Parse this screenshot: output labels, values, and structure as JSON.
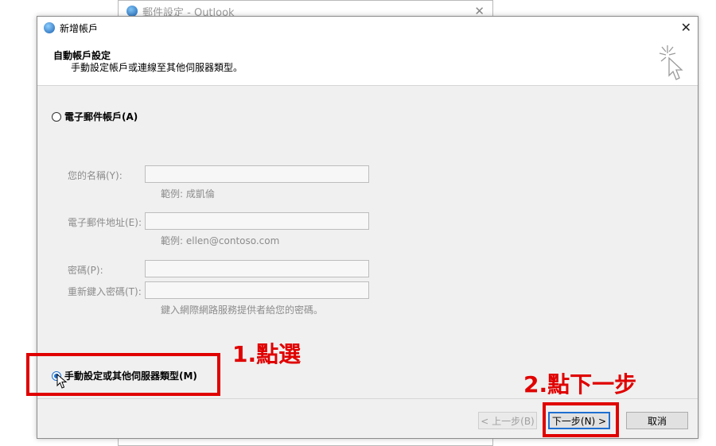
{
  "background_window": {
    "title": "郵件設定 - Outlook",
    "close": "✕"
  },
  "dialog": {
    "title": "新增帳戶",
    "close": "✕",
    "header": {
      "title": "自動帳戶設定",
      "subtitle": "手動設定帳戶或連線至其他伺服器類型。"
    },
    "email_account_option": "電子郵件帳戶(A)",
    "fields": {
      "name_label": "您的名稱(Y):",
      "name_hint": "範例: 成凱倫",
      "email_label": "電子郵件地址(E):",
      "email_hint": "範例: ellen@contoso.com",
      "password_label": "密碼(P):",
      "retype_label": "重新鍵入密碼(T):",
      "password_hint": "鍵入網際網路服務提供者給您的密碼。"
    },
    "manual_option": "手動設定或其他伺服器類型(M)",
    "buttons": {
      "back": "< 上一步(B)",
      "next": "下一步(N) >",
      "cancel": "取消"
    }
  },
  "annotations": {
    "step1": "1.點選",
    "step2": "2.點下一步"
  },
  "colors": {
    "annotation_red": "#e00000",
    "accent_blue": "#1e6fd1"
  }
}
